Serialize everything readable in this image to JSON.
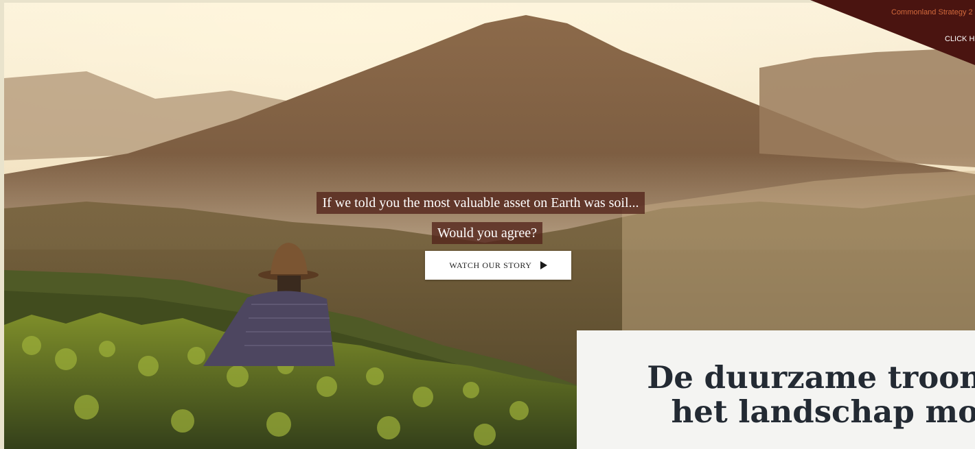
{
  "banner": {
    "title": "Commonland Strategy 2",
    "cta": "CLICK H"
  },
  "hero": {
    "line1": "If we told you the most valuable asset on Earth was soil...",
    "line2": "Would you agree?",
    "button_label": "WATCH OUR STORY",
    "button_icon": "play-icon"
  },
  "popup": {
    "title": "De duurzame troonrec\nhet landschap moet"
  },
  "colors": {
    "tagline_bg": "#52221a",
    "banner_bg": "#4a1410",
    "banner_title": "#d36a3c",
    "popup_bg": "#f4f4f2",
    "popup_text": "#232a33"
  }
}
